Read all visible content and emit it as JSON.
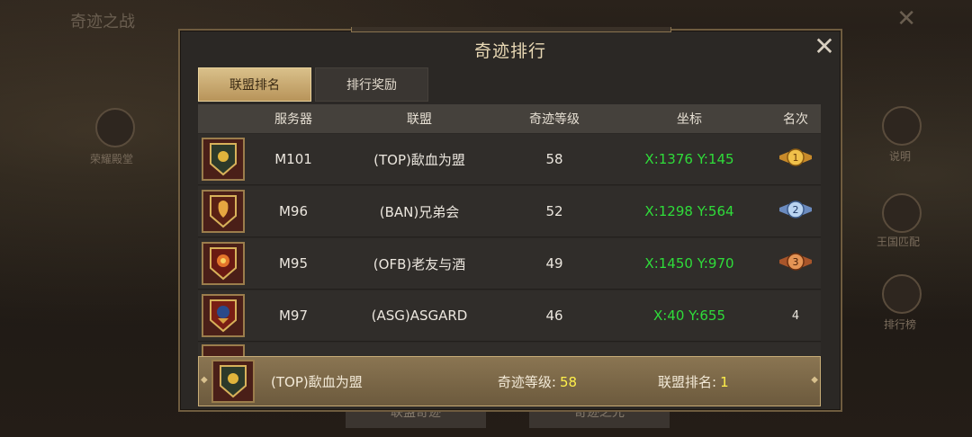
{
  "background": {
    "title": "奇迹之战",
    "left_label": "荣耀殿堂",
    "right_labels": [
      "说明",
      "王国匹配",
      "排行榜"
    ],
    "bottom_buttons": [
      "联盟奇迹",
      "奇迹之光"
    ]
  },
  "panel": {
    "title": "奇迹排行",
    "tabs": [
      {
        "label": "联盟排名",
        "active": true
      },
      {
        "label": "排行奖励",
        "active": false
      }
    ],
    "headers": [
      "服务器",
      "联盟",
      "奇迹等级",
      "坐标",
      "名次"
    ],
    "rows": [
      {
        "server": "M101",
        "alliance": "(TOP)歃血为盟",
        "level": "58",
        "coords": "X:1376 Y:145",
        "rank": "1",
        "medal": "gold"
      },
      {
        "server": "M96",
        "alliance": "(BAN)兄弟会",
        "level": "52",
        "coords": "X:1298 Y:564",
        "rank": "2",
        "medal": "silver"
      },
      {
        "server": "M95",
        "alliance": "(OFB)老友与酒",
        "level": "49",
        "coords": "X:1450 Y:970",
        "rank": "3",
        "medal": "bronze"
      },
      {
        "server": "M97",
        "alliance": "(ASG)ASGARD",
        "level": "46",
        "coords": "X:40 Y:655",
        "rank": "4",
        "medal": null
      }
    ],
    "my_alliance": {
      "name": "(TOP)歃血为盟",
      "level_label": "奇迹等级:",
      "level_value": "58",
      "rank_label": "联盟排名:",
      "rank_value": "1"
    }
  },
  "colors": {
    "coords": "#2fdc3a",
    "highlight_value": "#fff04a",
    "gold_accent": "#d9c08a"
  }
}
